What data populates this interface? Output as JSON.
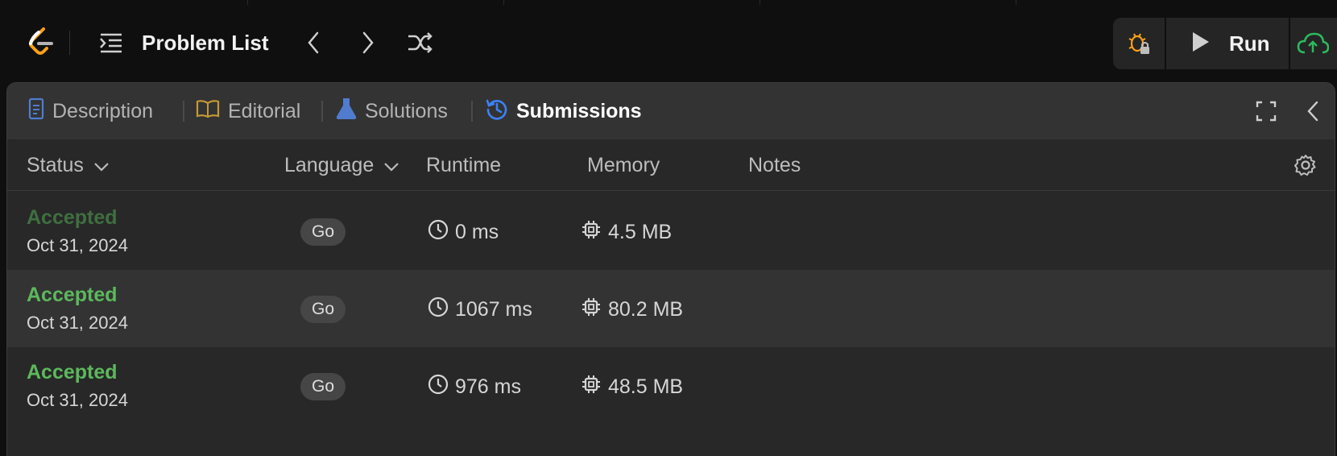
{
  "topbar": {
    "problem_list_label": "Problem List",
    "run_label": "Run",
    "icons": {
      "logo": "leetcode-logo",
      "problem_list": "list-indent-icon",
      "prev": "chevron-left-icon",
      "next": "chevron-right-icon",
      "shuffle": "shuffle-icon",
      "debug": "bug-lock-icon",
      "run": "play-icon",
      "submit": "cloud-upload-icon"
    }
  },
  "tabs": [
    {
      "label": "Description",
      "icon": "document-icon",
      "color": "#4f7ccf"
    },
    {
      "label": "Editorial",
      "icon": "book-icon",
      "color": "#c49a35"
    },
    {
      "label": "Solutions",
      "icon": "flask-icon",
      "color": "#4f7ccf"
    },
    {
      "label": "Submissions",
      "icon": "history-icon",
      "color": "#3b82f6",
      "active": true
    }
  ],
  "table": {
    "headers": {
      "status": "Status",
      "language": "Language",
      "runtime": "Runtime",
      "memory": "Memory",
      "notes": "Notes"
    },
    "rows": [
      {
        "status": "Accepted",
        "date": "Oct 31, 2024",
        "language": "Go",
        "runtime": "0 ms",
        "memory": "4.5 MB"
      },
      {
        "status": "Accepted",
        "date": "Oct 31, 2024",
        "language": "Go",
        "runtime": "1067 ms",
        "memory": "80.2 MB"
      },
      {
        "status": "Accepted",
        "date": "Oct 31, 2024",
        "language": "Go",
        "runtime": "976 ms",
        "memory": "48.5 MB"
      }
    ]
  },
  "colors": {
    "accepted": "#5cb85c",
    "accepted_dim": "#3f6f40",
    "logo_orange": "#ffa116",
    "cloud_green": "#2cbb5d"
  }
}
